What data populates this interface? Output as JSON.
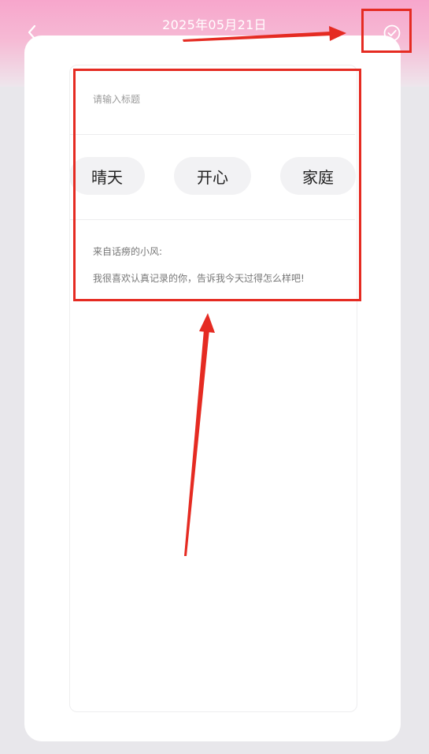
{
  "header": {
    "date": "2025年05月21日",
    "back_icon": "chevron-left-icon",
    "confirm_icon": "check-circle-icon"
  },
  "editor": {
    "title_placeholder": "请输入标题",
    "tags": [
      "晴天",
      "开心",
      "家庭"
    ],
    "message_from": "来自话痨的小风:",
    "message_body": "我很喜欢认真记录的你，告诉我今天过得怎么样吧!"
  },
  "colors": {
    "annotation_red": "#e52b22",
    "header_pink": "#f7a6cc",
    "tag_background": "#f2f2f4"
  }
}
